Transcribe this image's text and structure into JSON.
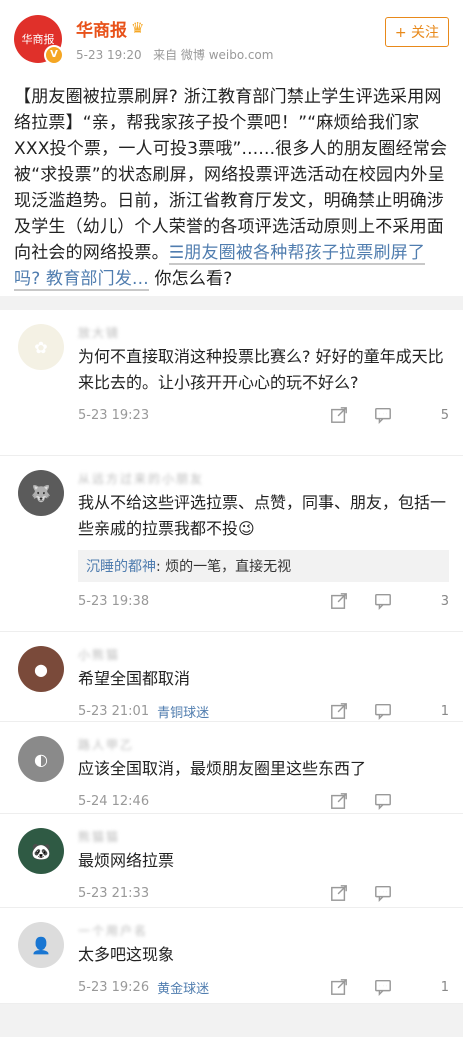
{
  "post": {
    "author": "华商报",
    "avatar_text": "华商报",
    "time": "5-23 19:20",
    "source": "来自 微博 weibo.com",
    "follow_label": "+ 关注",
    "text_main": "【朋友圈被拉票刷屏? 浙江教育部门禁止学生评选采用网络拉票】“亲，帮我家孩子投个票吧！”“麻烦给我们家XXX投个票，一人可投3票哦”......很多人的朋友圈经常会被“求投票”的状态刷屏，网络投票评选活动在校园内外呈现泛滥趋势。日前，浙江省教育厅发文，明确禁止明确涉及学生（幼儿）个人荣誉的各项评选活动原则上不采用面向社会的网络投票。",
    "link_text": "☰朋友圈被各种帮孩子拉票刷屏了吗? 教育部门发...",
    "tail_text": " 你怎么看?"
  },
  "comments": [
    {
      "name": "放大镜",
      "text": "为何不直接取消这种投票比赛么? 好好的童年成天比来比去的。让小孩开开心心的玩不好么?",
      "time": "5-23 19:23",
      "tag": "",
      "likes": "5",
      "reply": null,
      "avatar_color": "#f4f1e4",
      "avatar_glyph": "✿"
    },
    {
      "name": "从远方过来的小朋友",
      "text": "我从不给这些评选拉票、点赞，同事、朋友，包括一些亲戚的拉票我都不投😉",
      "time": "5-23 19:38",
      "tag": "",
      "likes": "3",
      "reply": {
        "name": "沉睡的都神",
        "text": ": 烦的一笔，直接无视"
      },
      "avatar_color": "#5b5b5b",
      "avatar_glyph": "🐺"
    },
    {
      "name": "小熊猫",
      "text": "希望全国都取消",
      "time": "5-23 21:01",
      "tag": "青铜球迷",
      "likes": "1",
      "reply": null,
      "avatar_color": "#7a4a3a",
      "avatar_glyph": "●"
    },
    {
      "name": "路人甲乙",
      "text": "应该全国取消，最烦朋友圈里这些东西了",
      "time": "5-24 12:46",
      "tag": "",
      "likes": "",
      "reply": null,
      "avatar_color": "#8a8a8a",
      "avatar_glyph": "◐"
    },
    {
      "name": "熊猫猫",
      "text": "最烦网络拉票",
      "time": "5-23 21:33",
      "tag": "",
      "likes": "",
      "reply": null,
      "avatar_color": "#2f5a44",
      "avatar_glyph": "🐼"
    },
    {
      "name": "一个用户名",
      "text": "太多吧这现象",
      "time": "5-23 19:26",
      "tag": "黄金球迷",
      "likes": "1",
      "reply": null,
      "avatar_color": "#dcdcdc",
      "avatar_glyph": "👤"
    }
  ]
}
